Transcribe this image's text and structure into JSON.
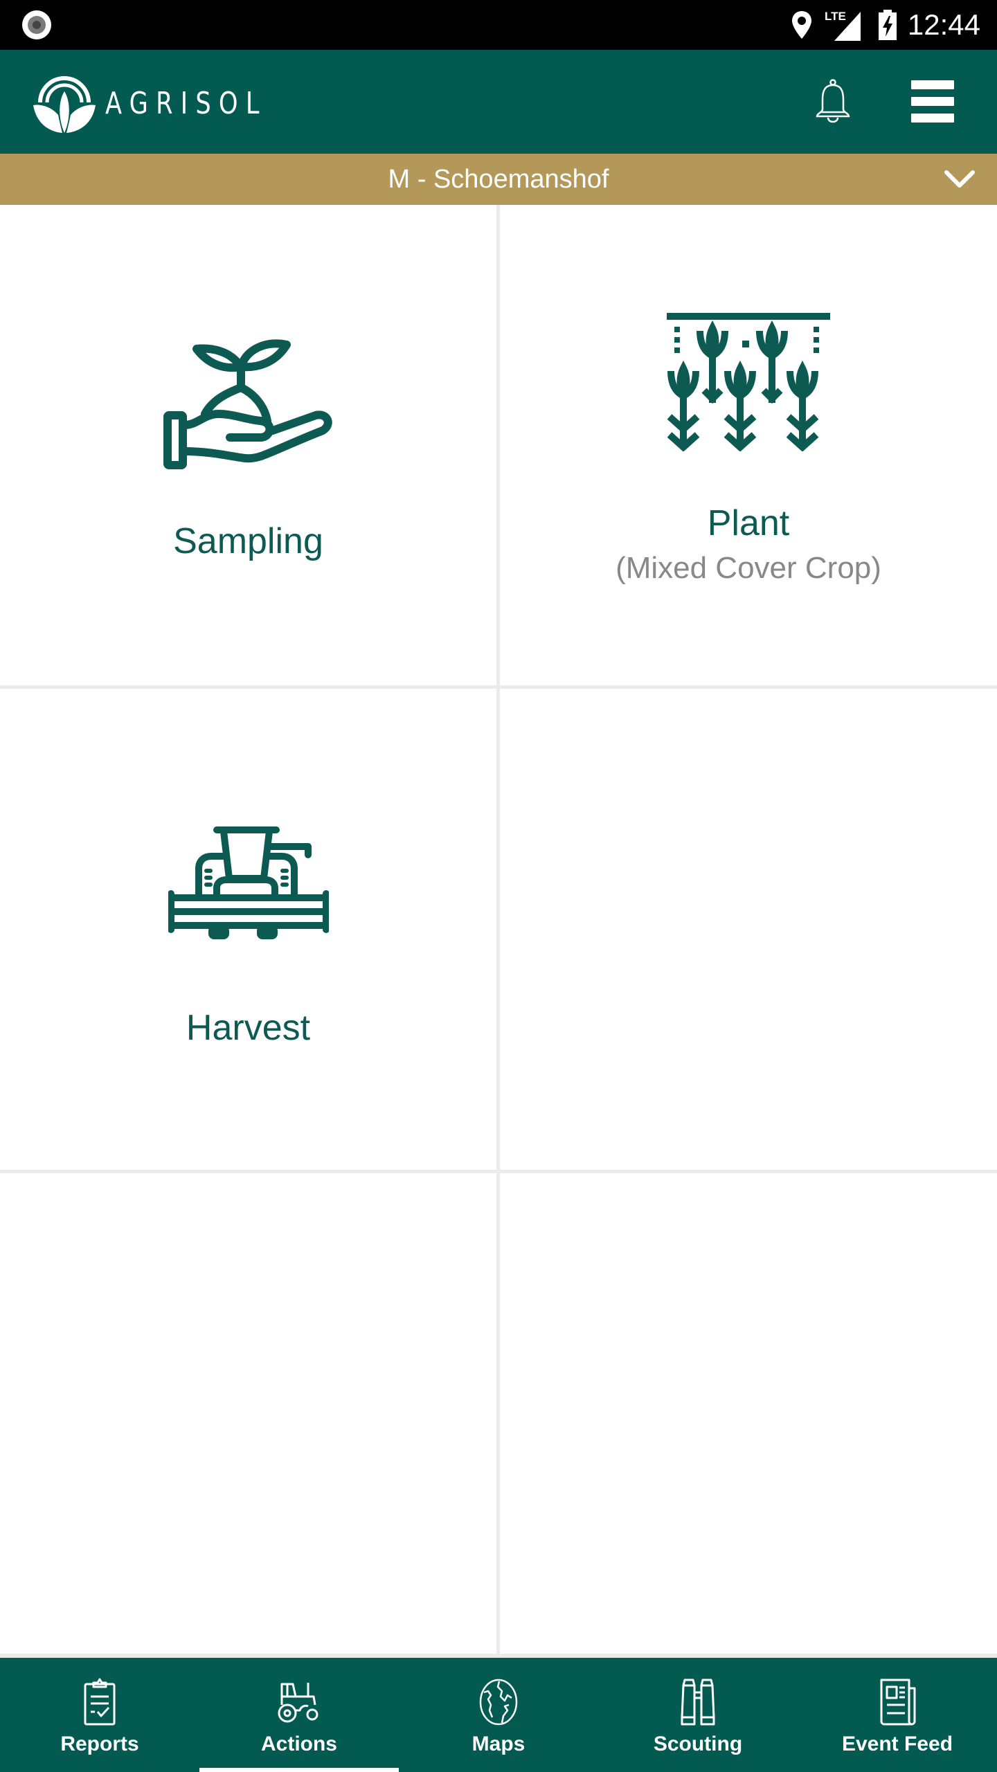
{
  "status_bar": {
    "time": "12:44",
    "network": "LTE",
    "icons": [
      "screen-record-icon",
      "location-icon",
      "lte-signal-icon",
      "battery-charging-icon"
    ]
  },
  "header": {
    "brand": "AGRISOL",
    "logo_icon": "agrisol-leaf-logo",
    "notification_icon": "bell-icon",
    "menu_icon": "hamburger-menu-icon"
  },
  "farm_selector": {
    "selected": "M - Schoemanshof",
    "icon": "chevron-down-icon"
  },
  "actions": [
    {
      "title": "Sampling",
      "subtitle": "",
      "icon": "hand-seedling-icon"
    },
    {
      "title": "Plant",
      "subtitle": "(Mixed Cover Crop)",
      "icon": "crop-rows-icon"
    },
    {
      "title": "Harvest",
      "subtitle": "",
      "icon": "combine-harvester-icon"
    }
  ],
  "bottom_nav": {
    "active": "Actions",
    "tabs": [
      {
        "label": "Reports",
        "icon": "clipboard-check-icon"
      },
      {
        "label": "Actions",
        "icon": "tractor-icon"
      },
      {
        "label": "Maps",
        "icon": "globe-icon"
      },
      {
        "label": "Scouting",
        "icon": "binoculars-icon"
      },
      {
        "label": "Event Feed",
        "icon": "newspaper-icon"
      }
    ]
  },
  "colors": {
    "primary": "#025a51",
    "accent_gold": "#b39859",
    "action_text": "#0d5a52",
    "subtitle_text": "#888888",
    "grid_divider": "#ebebeb"
  }
}
